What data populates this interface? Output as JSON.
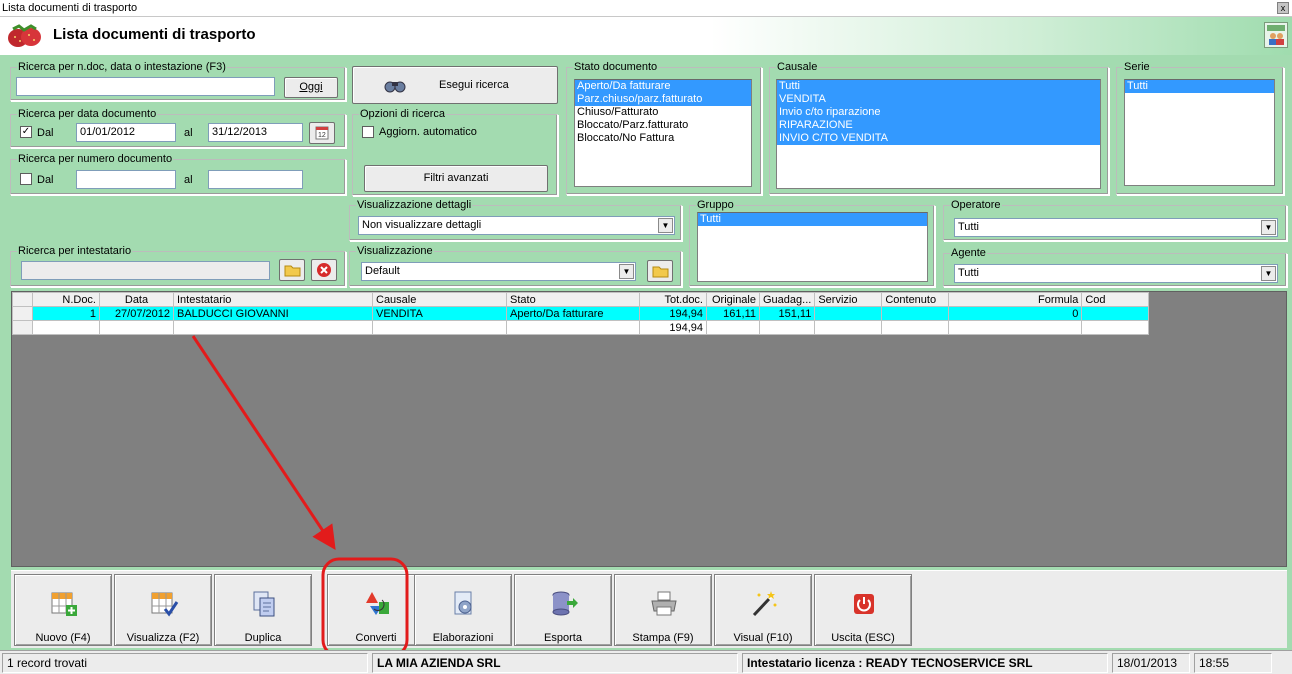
{
  "window_title": "Lista documenti di trasporto",
  "close_label": "x",
  "header_title": "Lista documenti di trasporto",
  "search_doc": {
    "legend": "Ricerca per n.doc, data o intestazione (F3)",
    "value": "",
    "today_button": "Oggi"
  },
  "search_date": {
    "legend": "Ricerca per data documento",
    "checked": "✓",
    "dal_label": "Dal",
    "from": "01/01/2012",
    "al_label": "al",
    "to": "31/12/2013"
  },
  "search_number": {
    "legend": "Ricerca per numero documento",
    "dal_label": "Dal",
    "from": "",
    "al_label": "al",
    "to": ""
  },
  "search_holder": {
    "legend": "Ricerca per intestatario",
    "value": ""
  },
  "execute_button": "Esegui ricerca",
  "search_options": {
    "legend": "Opzioni di ricerca",
    "auto_update": "Aggiorn. automatico",
    "advanced_filters": "Filtri avanzati"
  },
  "stato": {
    "legend": "Stato documento",
    "items": [
      {
        "label": "Aperto/Da fatturare",
        "sel": true
      },
      {
        "label": "Parz.chiuso/parz.fatturato",
        "sel": true
      },
      {
        "label": "Chiuso/Fatturato",
        "sel": false
      },
      {
        "label": "Bloccato/Parz.fatturato",
        "sel": false
      },
      {
        "label": "Bloccato/No Fattura",
        "sel": false
      }
    ]
  },
  "causale": {
    "legend": "Causale",
    "items": [
      {
        "label": "Tutti",
        "sel": true
      },
      {
        "label": "VENDITA",
        "sel": true
      },
      {
        "label": "Invio c/to riparazione",
        "sel": true
      },
      {
        "label": "RIPARAZIONE",
        "sel": true
      },
      {
        "label": "INVIO C/TO VENDITA",
        "sel": true
      }
    ]
  },
  "serie": {
    "legend": "Serie",
    "items": [
      {
        "label": "Tutti",
        "sel": true
      }
    ]
  },
  "gruppo": {
    "legend": "Gruppo",
    "items": [
      {
        "label": "Tutti",
        "sel": true
      }
    ]
  },
  "vis_dettagli": {
    "legend": "Visualizzazione dettagli",
    "value": "Non visualizzare dettagli"
  },
  "visualizzazione": {
    "legend": "Visualizzazione",
    "value": "Default"
  },
  "operatore": {
    "legend": "Operatore",
    "value": "Tutti"
  },
  "agente": {
    "legend": "Agente",
    "value": "Tutti"
  },
  "table": {
    "headers": [
      "",
      "N.Doc.",
      "Data",
      "Intestatario",
      "Causale",
      "Stato",
      "Tot.doc.",
      "Originale",
      "Guadag...",
      "Servizio",
      "Contenuto",
      "Formula",
      "Cod"
    ],
    "rows": [
      [
        "",
        "1",
        "27/07/2012",
        "BALDUCCI GIOVANNI",
        "VENDITA",
        "Aperto/Da fatturare",
        "194,94",
        "161,11",
        "151,11",
        "",
        "",
        "0",
        ""
      ],
      [
        "",
        "",
        "",
        "",
        "",
        "",
        "194,94",
        "",
        "",
        "",
        "",
        "",
        ""
      ]
    ]
  },
  "toolbar": [
    {
      "label": "Nuovo (F4)",
      "icon": "grid-add-icon"
    },
    {
      "label": "Visualizza (F2)",
      "icon": "grid-check-icon"
    },
    {
      "label": "Duplica",
      "icon": "duplicate-icon"
    },
    {
      "label": "Converti",
      "icon": "convert-icon"
    },
    {
      "label": "Elaborazioni",
      "icon": "gear-doc-icon"
    },
    {
      "label": "Esporta",
      "icon": "export-icon"
    },
    {
      "label": "Stampa (F9)",
      "icon": "printer-icon"
    },
    {
      "label": "Visual (F10)",
      "icon": "magic-wand-icon"
    },
    {
      "label": "Uscita (ESC)",
      "icon": "power-icon"
    }
  ],
  "status": {
    "records": "1 record trovati",
    "company": "LA MIA AZIENDA SRL",
    "license": "Intestatario licenza : READY TECNOSERVICE SRL",
    "date": "18/01/2013",
    "time": "18:55"
  },
  "colors": {
    "accent": "#3399ff",
    "highlight_row": "#00ffff",
    "annotation": "#e21b1b",
    "background": "#a3dbb0"
  }
}
